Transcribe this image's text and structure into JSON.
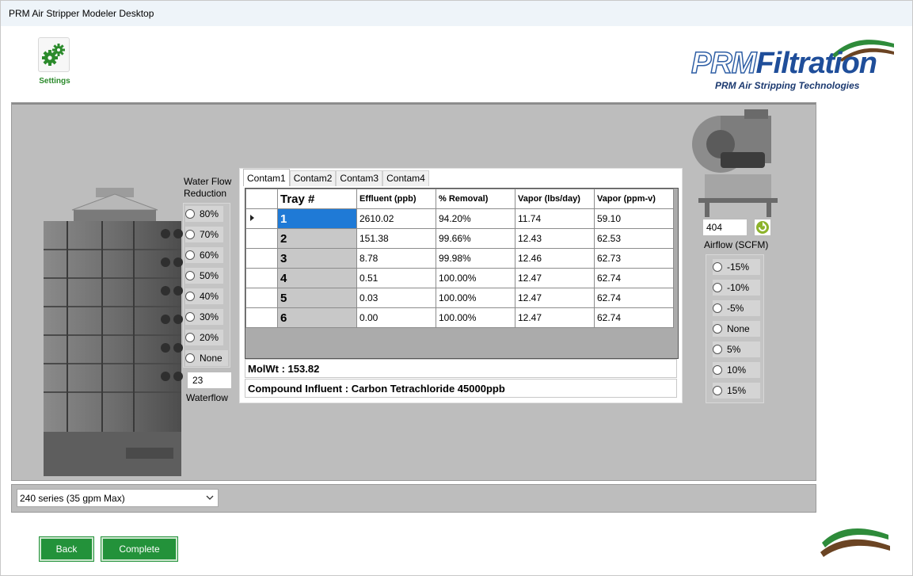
{
  "window": {
    "title": "PRM Air Stripper Modeler Desktop"
  },
  "header": {
    "settings_label": "Settings",
    "logo": {
      "brand_a": "PRM",
      "brand_b": "Filtration",
      "tagline": "PRM Air Stripping Technologies"
    }
  },
  "water_flow": {
    "title": "Water Flow Reduction",
    "options": [
      "80%",
      "70%",
      "60%",
      "50%",
      "40%",
      "30%",
      "20%",
      "None"
    ],
    "value": "23",
    "value_label": "Waterflow"
  },
  "contaminants": {
    "tabs": [
      "Contam1",
      "Contam2",
      "Contam3",
      "Contam4"
    ],
    "active_tab": "Contam1",
    "columns": [
      "Tray #",
      "Effluent (ppb)",
      "% Removal)",
      "Vapor (lbs/day)",
      "Vapor (ppm-v)"
    ],
    "rows": [
      {
        "tray": "1",
        "effluent": "2610.02",
        "removal": "94.20%",
        "vapor_lbs": "11.74",
        "vapor_ppm": "59.10"
      },
      {
        "tray": "2",
        "effluent": "151.38",
        "removal": "99.66%",
        "vapor_lbs": "12.43",
        "vapor_ppm": "62.53"
      },
      {
        "tray": "3",
        "effluent": "8.78",
        "removal": "99.98%",
        "vapor_lbs": "12.46",
        "vapor_ppm": "62.73"
      },
      {
        "tray": "4",
        "effluent": "0.51",
        "removal": "100.00%",
        "vapor_lbs": "12.47",
        "vapor_ppm": "62.74"
      },
      {
        "tray": "5",
        "effluent": "0.03",
        "removal": "100.00%",
        "vapor_lbs": "12.47",
        "vapor_ppm": "62.74"
      },
      {
        "tray": "6",
        "effluent": "0.00",
        "removal": "100.00%",
        "vapor_lbs": "12.47",
        "vapor_ppm": "62.74"
      }
    ],
    "molwt": "MolWt : 153.82",
    "compound": "Compound Influent : Carbon Tetrachloride  45000ppb"
  },
  "airflow": {
    "value": "404",
    "label": "Airflow  (SCFM)",
    "options": [
      "-15%",
      "-10%",
      "-5%",
      "None",
      "5%",
      "10%",
      "15%"
    ]
  },
  "series": {
    "selected": "240 series (35 gpm Max)"
  },
  "buttons": {
    "back": "Back",
    "complete": "Complete"
  },
  "colors": {
    "accent_green": "#23923a",
    "brand_blue": "#1f4e9a",
    "selection_blue": "#1f7ad6",
    "panel_gray": "#bdbdbd"
  },
  "icons": {
    "settings": "gears-icon",
    "refresh": "refresh-icon",
    "dropdown": "chevron-down-icon",
    "row_pointer": "triangle-right-icon"
  }
}
